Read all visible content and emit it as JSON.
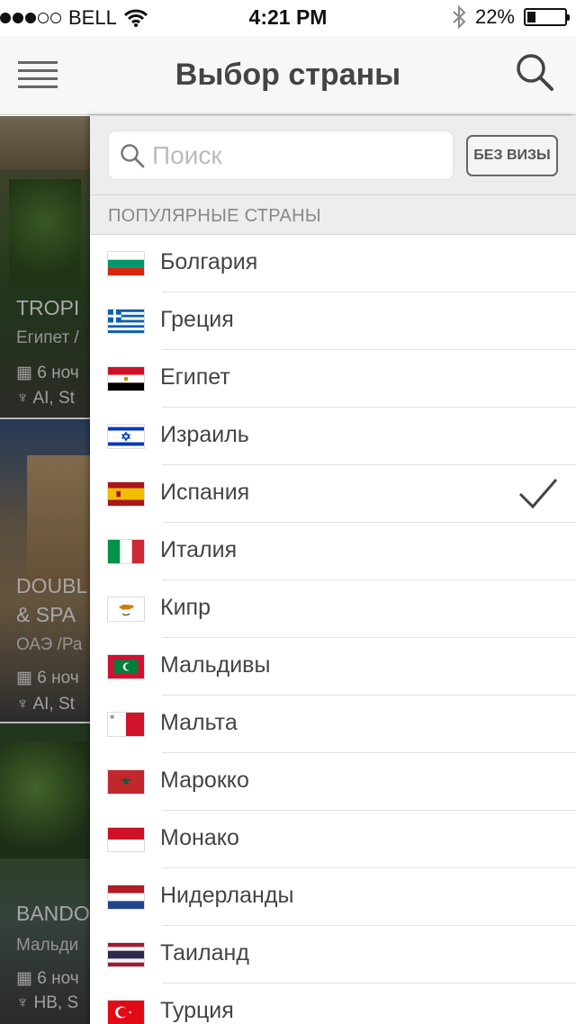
{
  "status_bar": {
    "carrier": "BELL",
    "time": "4:21 PM",
    "battery": "22%",
    "battery_level": 0.22
  },
  "header": {
    "title": "Выбор страны"
  },
  "search": {
    "placeholder": "Поиск",
    "visa_button": "БЕЗ ВИЗЫ"
  },
  "section_title": "ПОПУЛЯРНЫЕ СТРАНЫ",
  "countries": [
    {
      "name": "Болгария",
      "flag": "bulgaria",
      "selected": false
    },
    {
      "name": "Греция",
      "flag": "greece",
      "selected": false
    },
    {
      "name": "Египет",
      "flag": "egypt",
      "selected": false
    },
    {
      "name": "Израиль",
      "flag": "israel",
      "selected": false
    },
    {
      "name": "Испания",
      "flag": "spain",
      "selected": true
    },
    {
      "name": "Италия",
      "flag": "italy",
      "selected": false
    },
    {
      "name": "Кипр",
      "flag": "cyprus",
      "selected": false
    },
    {
      "name": "Мальдивы",
      "flag": "maldives",
      "selected": false
    },
    {
      "name": "Мальта",
      "flag": "malta",
      "selected": false
    },
    {
      "name": "Марокко",
      "flag": "morocco",
      "selected": false
    },
    {
      "name": "Монако",
      "flag": "monaco",
      "selected": false
    },
    {
      "name": "Нидерланды",
      "flag": "netherlands",
      "selected": false
    },
    {
      "name": "Таиланд",
      "flag": "thailand",
      "selected": false
    },
    {
      "name": "Турция",
      "flag": "turkey",
      "selected": false
    }
  ],
  "background_cards": [
    {
      "title": "TROPI",
      "subtitle": "Египет /",
      "nights": "6 ноч",
      "meal": "AI, St"
    },
    {
      "title": "DOUBL",
      "title2": "& SPA",
      "subtitle": "ОАЭ /Ра",
      "nights": "6 ноч",
      "meal": "AI, St"
    },
    {
      "title": "BANDO",
      "subtitle": "Мальди",
      "nights": "6 ноч",
      "meal": "HB, S"
    }
  ],
  "colors": {
    "check": "#444444",
    "navbar_bg": "#f7f7f7",
    "section_bg": "#ededed"
  }
}
